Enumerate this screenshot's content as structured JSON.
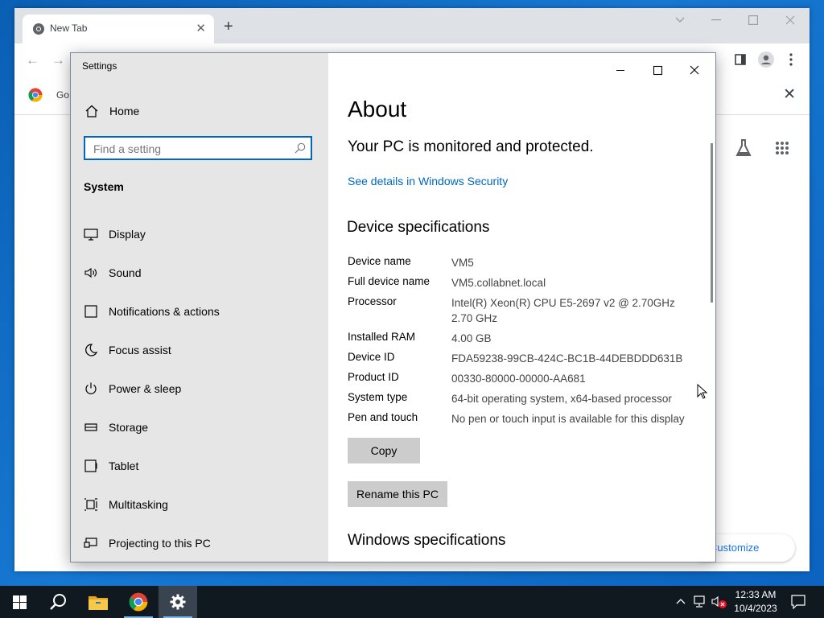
{
  "chrome": {
    "tab_title": "New Tab",
    "bookmark_label": "Go",
    "customize_label": "Customize Chrome"
  },
  "settings": {
    "window_title": "Settings",
    "home_label": "Home",
    "search_placeholder": "Find a setting",
    "group_label": "System",
    "nav_items": [
      {
        "label": "Display",
        "icon": "display-icon"
      },
      {
        "label": "Sound",
        "icon": "sound-icon"
      },
      {
        "label": "Notifications & actions",
        "icon": "notifications-icon"
      },
      {
        "label": "Focus assist",
        "icon": "focus-assist-icon"
      },
      {
        "label": "Power & sleep",
        "icon": "power-icon"
      },
      {
        "label": "Storage",
        "icon": "storage-icon"
      },
      {
        "label": "Tablet",
        "icon": "tablet-icon"
      },
      {
        "label": "Multitasking",
        "icon": "multitasking-icon"
      },
      {
        "label": "Projecting to this PC",
        "icon": "projecting-icon"
      }
    ],
    "about": {
      "title": "About",
      "protection_message": "Your PC is monitored and protected.",
      "security_link": "See details in Windows Security",
      "device_specs_heading": "Device specifications",
      "specs": [
        {
          "key": "Device name",
          "value": "VM5"
        },
        {
          "key": "Full device name",
          "value": "VM5.collabnet.local"
        },
        {
          "key": "Processor",
          "value": "Intel(R) Xeon(R) CPU E5-2697 v2 @ 2.70GHz\n2.70 GHz"
        },
        {
          "key": "Installed RAM",
          "value": "4.00 GB"
        },
        {
          "key": "Device ID",
          "value": "FDA59238-99CB-424C-BC1B-44DEBDDD631B"
        },
        {
          "key": "Product ID",
          "value": "00330-80000-00000-AA681"
        },
        {
          "key": "System type",
          "value": "64-bit operating system, x64-based processor"
        },
        {
          "key": "Pen and touch",
          "value": "No pen or touch input is available for this display"
        }
      ],
      "copy_label": "Copy",
      "rename_label": "Rename this PC",
      "windows_specs_heading": "Windows specifications"
    }
  },
  "taskbar": {
    "time": "12:33 AM",
    "date": "10/4/2023"
  },
  "colors": {
    "accent": "#0067c0",
    "desktop": "#0a5fb4",
    "taskbar": "#101820"
  }
}
